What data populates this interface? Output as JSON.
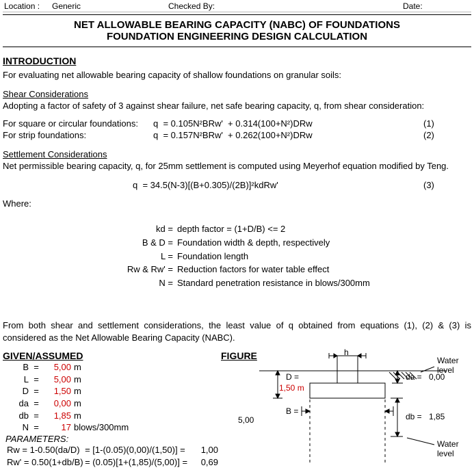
{
  "header": {
    "location_label": "Location :",
    "location_value": "Generic",
    "checked_label": "Checked By:",
    "checked_value": "",
    "date_label": "Date:",
    "date_value": ""
  },
  "title": "NET ALLOWABLE BEARING CAPACITY (NABC) OF FOUNDATIONS",
  "subtitle": "FOUNDATION ENGINEERING DESIGN CALCULATION",
  "sections": {
    "intro_hd": "INTRODUCTION",
    "intro_p1": "For evaluating net allowable bearing capacity of shallow foundations on granular soils:",
    "shear_hd": "Shear Considerations",
    "shear_p1": "Adopting a factor of safety of 3 against shear failure, net safe bearing capacity, q, from shear consideration:",
    "eq1_label": "For square or circular foundations:",
    "eq1_formula": "q  = 0.105N²BRw'  + 0.314(100+N²)DRw",
    "eq1_no": "(1)",
    "eq2_label": "For strip foundations:",
    "eq2_formula": "q  = 0.157N²BRw'  + 0.262(100+N²)DRw",
    "eq2_no": "(2)",
    "settle_hd": "Settlement Considerations",
    "settle_p1": "Net permissible bearing capacity, q, for 25mm settlement is computed using Meyerhof equation modified by Teng.",
    "eq3_formula": "q  = 34.5(N-3)[(B+0.305)/(2B)]²kdRw'",
    "eq3_no": "(3)",
    "where_label": "Where:",
    "where_rows": [
      {
        "l": "kd",
        "r": "depth factor = (1+D/B) <= 2"
      },
      {
        "l": "B & D",
        "r": "Foundation width & depth, respectively"
      },
      {
        "l": "L",
        "r": "Foundation length"
      },
      {
        "l": "Rw & Rw'",
        "r": "Reduction factors for water table effect"
      },
      {
        "l": "N",
        "r": "Standard penetration resistance in blows/300mm"
      }
    ],
    "closing_p": "From both shear and settlement considerations, the least value of q obtained from equations (1), (2) & (3) is considered as the Net Allowable Bearing Capacity (NABC)."
  },
  "given": {
    "hd": "GIVEN/ASSUMED",
    "rows": [
      {
        "sym": "B",
        "val": "5,00",
        "unit": "m"
      },
      {
        "sym": "L",
        "val": "5,00",
        "unit": "m"
      },
      {
        "sym": "D",
        "val": "1,50",
        "unit": "m"
      },
      {
        "sym": "da",
        "val": "0,00",
        "unit": "m"
      },
      {
        "sym": "db",
        "val": "1,85",
        "unit": "m"
      },
      {
        "sym": "N",
        "val": "17",
        "unit": "blows/300mm"
      }
    ],
    "params_hd": "PARAMETERS:",
    "param_rows": [
      {
        "a": "Rw = 1-0.50(da/D)",
        "b": "= [1-(0.05)(0,00)/(1,50)] =",
        "c": "1,00"
      },
      {
        "a": "Rw' = 0.50(1+db/B)",
        "b": "= (0.05)[1+(1,85)/(5,00)] =",
        "c": "0,69"
      }
    ]
  },
  "figure": {
    "hd": "FIGURE",
    "h_label": "h",
    "D_label": "D =",
    "D_val": "1,50 m",
    "da_label": "da =",
    "da_val": "0,00",
    "db_label": "db =",
    "db_val": "1,85",
    "B_label": "B =",
    "B_val": "5,00",
    "water_label_top": "Water",
    "water_label_bot": "level"
  }
}
